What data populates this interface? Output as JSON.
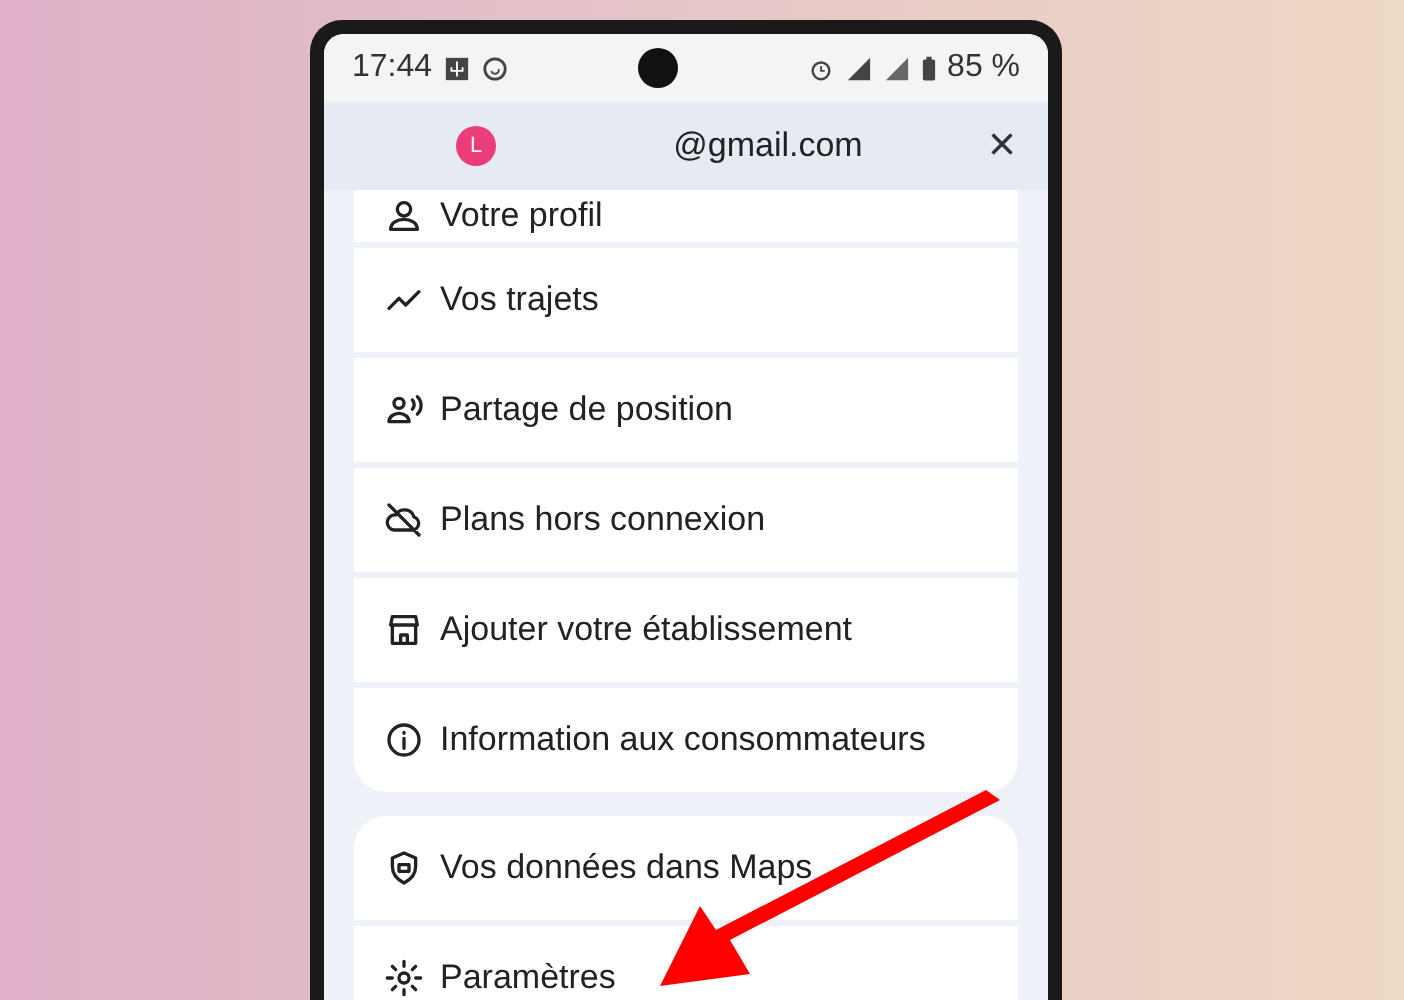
{
  "status_bar": {
    "time": "17:44",
    "battery": "85 %"
  },
  "account": {
    "avatar_letter": "L",
    "email": "@gmail.com",
    "close": "×"
  },
  "groups": [
    {
      "items": [
        {
          "label": "Votre profil"
        },
        {
          "label": "Vos trajets"
        },
        {
          "label": "Partage de position"
        },
        {
          "label": "Plans hors connexion"
        },
        {
          "label": "Ajouter votre établissement"
        },
        {
          "label": "Information aux consommateurs"
        }
      ]
    },
    {
      "items": [
        {
          "label": "Vos données dans Maps"
        },
        {
          "label": "Paramètres"
        }
      ]
    }
  ]
}
